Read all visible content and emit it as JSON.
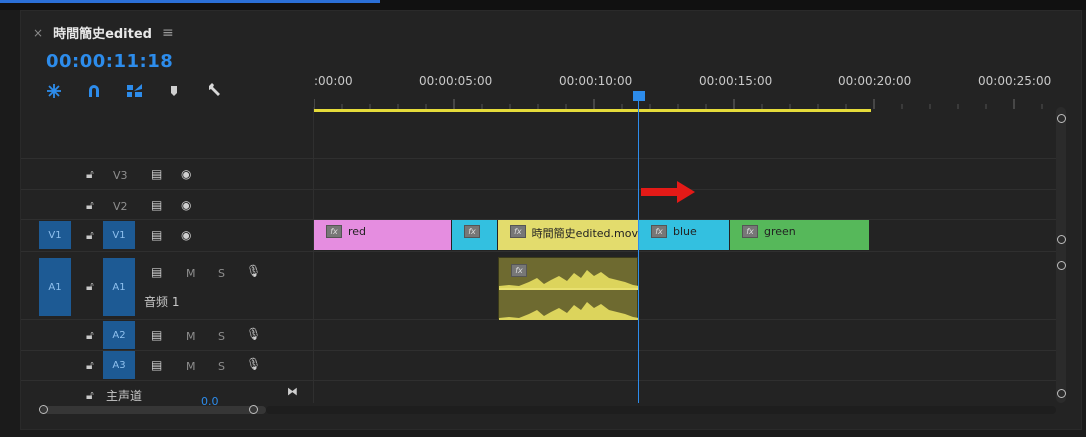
{
  "sequence": {
    "close_label": "×",
    "tab_name": "時間簡史edited",
    "menu_label": "≡",
    "timecode": "00:00:11:18"
  },
  "tools": [
    "ripple-icon",
    "magnet-icon",
    "linked-selection-icon",
    "marker-icon",
    "wrench-icon"
  ],
  "ruler": {
    "labels": [
      ":00:00",
      "00:00:05:00",
      "00:00:10:00",
      "00:00:15:00",
      "00:00:20:00",
      "00:00:25:00"
    ]
  },
  "tracks": {
    "v3": {
      "name": "V3"
    },
    "v2": {
      "name": "V2"
    },
    "v1": {
      "source": "V1",
      "name": "V1"
    },
    "a1": {
      "source": "A1",
      "name": "A1",
      "m": "M",
      "s": "S",
      "label": "音频 1"
    },
    "a2": {
      "name": "A2",
      "m": "M",
      "s": "S"
    },
    "a3": {
      "name": "A3",
      "m": "M",
      "s": "S"
    },
    "master": {
      "name": "主声道",
      "value": "0.0"
    }
  },
  "clips": {
    "fx_label": "fx",
    "red": "red",
    "edited": "時間簡史edited.mov",
    "blue": "blue",
    "green": "green"
  },
  "colors": {
    "accent": "#2d8ceb",
    "track_blue": "#1d5a94",
    "clip_pink": "#e58de0",
    "clip_cyan": "#33c0e0",
    "clip_yellow": "#e3dc6d",
    "clip_green": "#56b85a",
    "audio_bg": "#6e6a30",
    "audio_wave": "#dcd45c",
    "work_area": "#e5db3a",
    "arrow": "#e41a17"
  }
}
